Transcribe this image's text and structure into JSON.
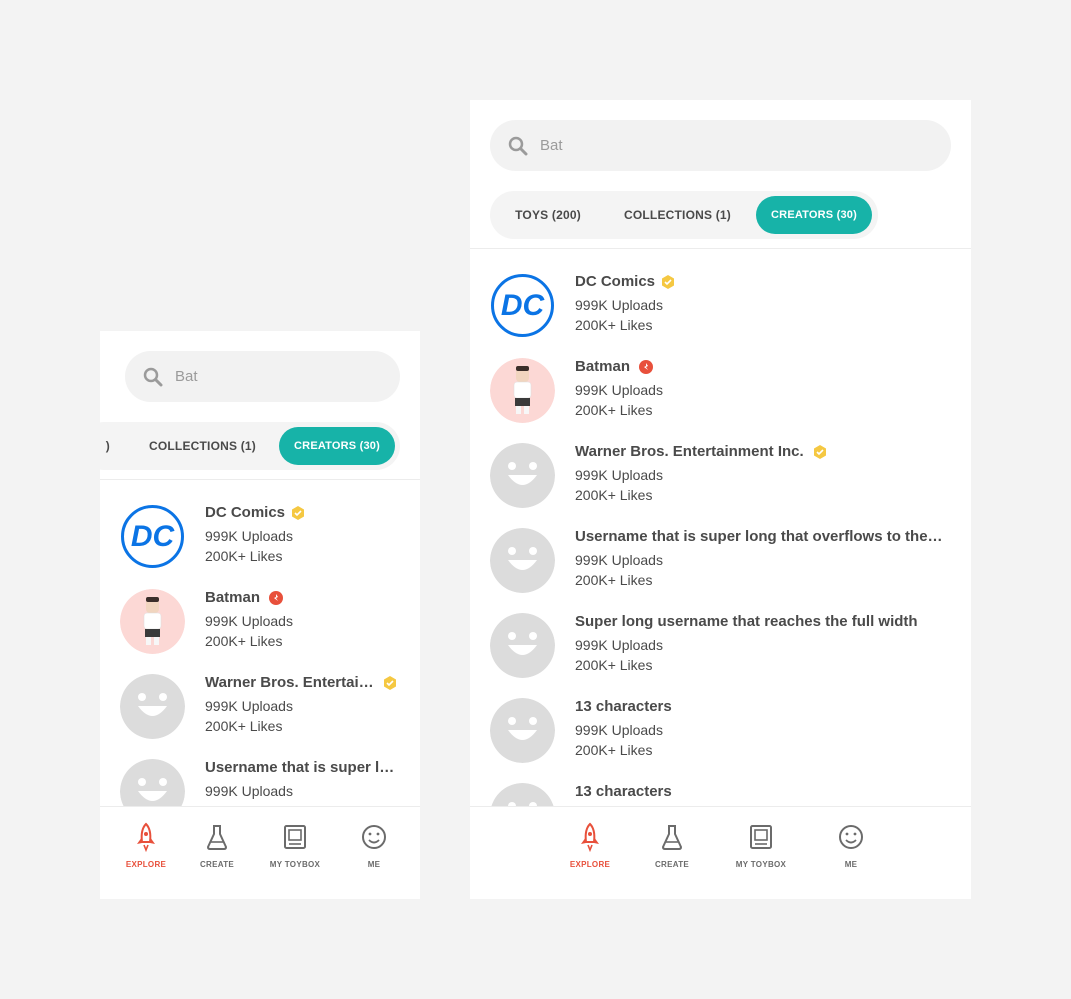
{
  "search": {
    "placeholder": "Bat"
  },
  "tabs": {
    "toys": "TOYS (200)",
    "toys_partial": ")",
    "collections": "COLLECTIONS (1)",
    "creators": "CREATORS (30)"
  },
  "creators": [
    {
      "name": "DC Comics",
      "short_name": "DC Comics",
      "uploads": "999K Uploads",
      "likes": "200K+ Likes",
      "avatar": "dc-logo",
      "badge": "gold-verified"
    },
    {
      "name": "Batman",
      "short_name": "Batman",
      "uploads": "999K Uploads",
      "likes": "200K+ Likes",
      "avatar": "batman-character",
      "badge": "red-verified"
    },
    {
      "name": "Warner Bros. Entertainment Inc.",
      "short_name": "Warner Bros. Entertai…",
      "uploads": "999K Uploads",
      "likes": "200K+ Likes",
      "avatar": "default-smiley",
      "badge": "gold-verified"
    },
    {
      "name": "Username that is super long that overflows to the…",
      "short_name": "Username that is super l…",
      "uploads": "999K Uploads",
      "likes": "200K+ Likes",
      "avatar": "default-smiley",
      "badge": ""
    },
    {
      "name": "Super long username that reaches the full width",
      "uploads": "999K Uploads",
      "likes": "200K+ Likes",
      "avatar": "default-smiley",
      "badge": ""
    },
    {
      "name": "13 characters",
      "uploads": "999K Uploads",
      "likes": "200K+ Likes",
      "avatar": "default-smiley",
      "badge": ""
    },
    {
      "name": "13 characters",
      "avatar": "default-smiley",
      "badge": ""
    }
  ],
  "nav": [
    {
      "label": "EXPLORE",
      "icon": "rocket-icon",
      "active": true
    },
    {
      "label": "CREATE",
      "icon": "flask-icon",
      "active": false
    },
    {
      "label": "MY TOYBOX",
      "icon": "toybox-icon",
      "active": false
    },
    {
      "label": "ME",
      "icon": "smiley-icon",
      "active": false
    }
  ],
  "colors": {
    "accent": "#17b3a8",
    "active_nav": "#e8503b",
    "gold_badge": "#f5c842",
    "red_badge": "#e8503b",
    "dc_blue": "#0b74e5"
  }
}
